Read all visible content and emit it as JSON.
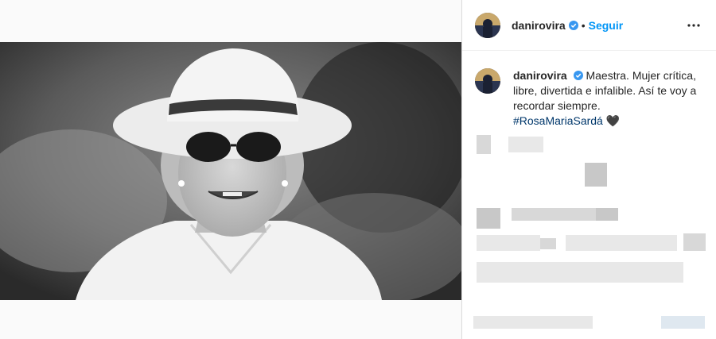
{
  "post": {
    "username": "danirovira",
    "separator": "•",
    "follow_label": "Seguir",
    "caption_text": "Maestra. Mujer crítica, libre, divertida e infalible. Así te voy a recordar siempre.",
    "hashtag": "#RosaMariaSardá",
    "emoji": "🖤"
  },
  "colors": {
    "accent": "#0095f6",
    "hashtag": "#00376b",
    "verified": "#3897f0"
  },
  "icons": {
    "verified": "verified-badge-icon",
    "more": "more-options-icon"
  }
}
